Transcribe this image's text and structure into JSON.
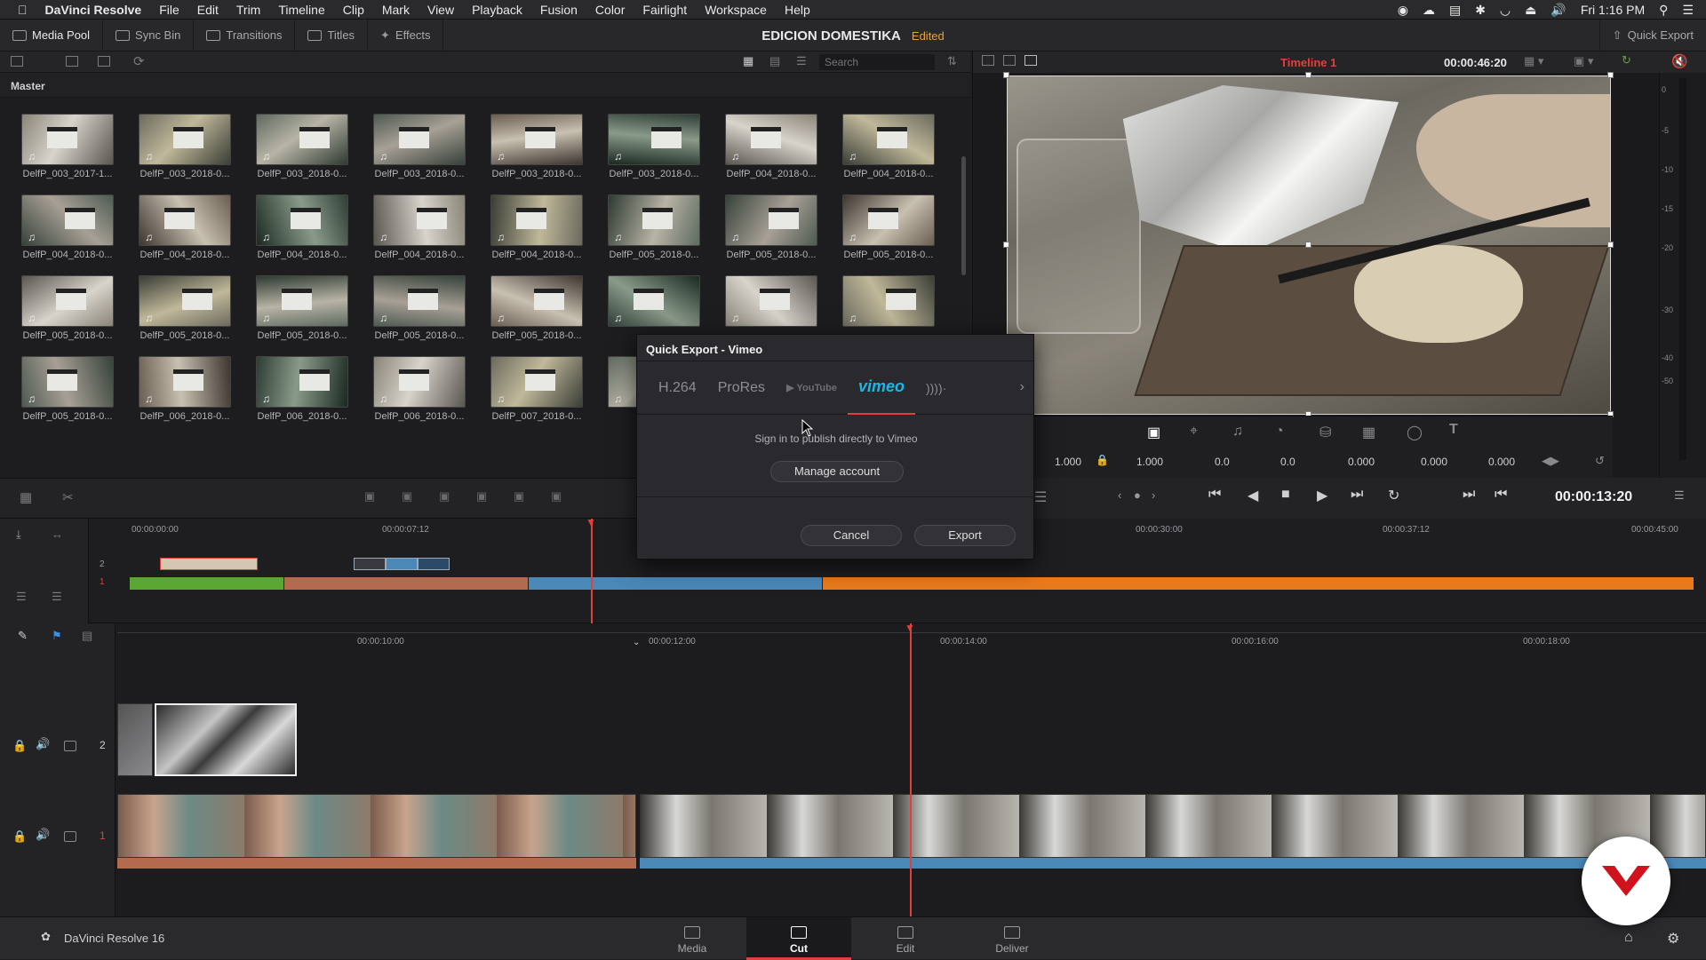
{
  "menubar": {
    "app": "DaVinci Resolve",
    "items": [
      "File",
      "Edit",
      "Trim",
      "Timeline",
      "Clip",
      "Mark",
      "View",
      "Playback",
      "Fusion",
      "Color",
      "Fairlight",
      "Workspace",
      "Help"
    ],
    "clock": "Fri 1:16 PM"
  },
  "toolbar": {
    "media_pool": "Media Pool",
    "sync_bin": "Sync Bin",
    "transitions": "Transitions",
    "titles": "Titles",
    "effects": "Effects",
    "project_title": "EDICION DOMESTIKA",
    "project_status": "Edited",
    "quick_export": "Quick Export"
  },
  "pool": {
    "search_placeholder": "Search",
    "bin": "Master",
    "clips": [
      "DelfP_003_2017-1...",
      "DelfP_003_2018-0...",
      "DelfP_003_2018-0...",
      "DelfP_003_2018-0...",
      "DelfP_003_2018-0...",
      "DelfP_003_2018-0...",
      "DelfP_004_2018-0...",
      "DelfP_004_2018-0...",
      "DelfP_004_2018-0...",
      "DelfP_004_2018-0...",
      "DelfP_004_2018-0...",
      "DelfP_004_2018-0...",
      "DelfP_004_2018-0...",
      "DelfP_005_2018-0...",
      "DelfP_005_2018-0...",
      "DelfP_005_2018-0...",
      "DelfP_005_2018-0...",
      "DelfP_005_2018-0...",
      "DelfP_005_2018-0...",
      "DelfP_005_2018-0...",
      "DelfP_005_2018-0...",
      "",
      "",
      "",
      "DelfP_005_2018-0...",
      "DelfP_006_2018-0...",
      "DelfP_006_2018-0...",
      "DelfP_006_2018-0...",
      "DelfP_007_2018-0...",
      "DelfP"
    ]
  },
  "viewer": {
    "timeline_name": "Timeline 1",
    "duration": "00:00:46:20",
    "timecode": "00:00:13:20",
    "transform": {
      "zoom_x": "1.000",
      "zoom_y": "1.000",
      "pos_x": "0.0",
      "pos_y": "0.0",
      "rotation": "0.000",
      "crop_a": "0.000",
      "crop_b": "0.000"
    },
    "meter_ticks": [
      "0",
      "-5",
      "-10",
      "-15",
      "-20",
      "-30",
      "-40",
      "-50"
    ]
  },
  "dialog": {
    "title": "Quick Export - Vimeo",
    "tabs": [
      "H.264",
      "ProRes",
      "YouTube",
      "vimeo",
      "))))·"
    ],
    "message": "Sign in to publish directly to Vimeo",
    "manage": "Manage account",
    "cancel": "Cancel",
    "export": "Export"
  },
  "timeline": {
    "upper_ruler": [
      "00:00:00:00",
      "00:00:07:12",
      "00:00:30:00",
      "00:00:37:12",
      "00:00:45:00"
    ],
    "lower_ruler": [
      "00:00:10:00",
      "00:00:12:00",
      "00:00:14:00",
      "00:00:16:00",
      "00:00:18:00"
    ],
    "tracks": [
      "2",
      "1"
    ]
  },
  "pages": {
    "app_label": "DaVinci Resolve 16",
    "items": [
      "Media",
      "Cut",
      "Edit",
      "Deliver"
    ]
  },
  "colors": {
    "accent": "#e0403a",
    "vimeo": "#1ab7ea",
    "clip_green": "#5aa832",
    "clip_brown": "#b36a4e",
    "clip_blue": "#4a88b8",
    "clip_orange": "#e87a1e",
    "status": "#e8a530"
  }
}
